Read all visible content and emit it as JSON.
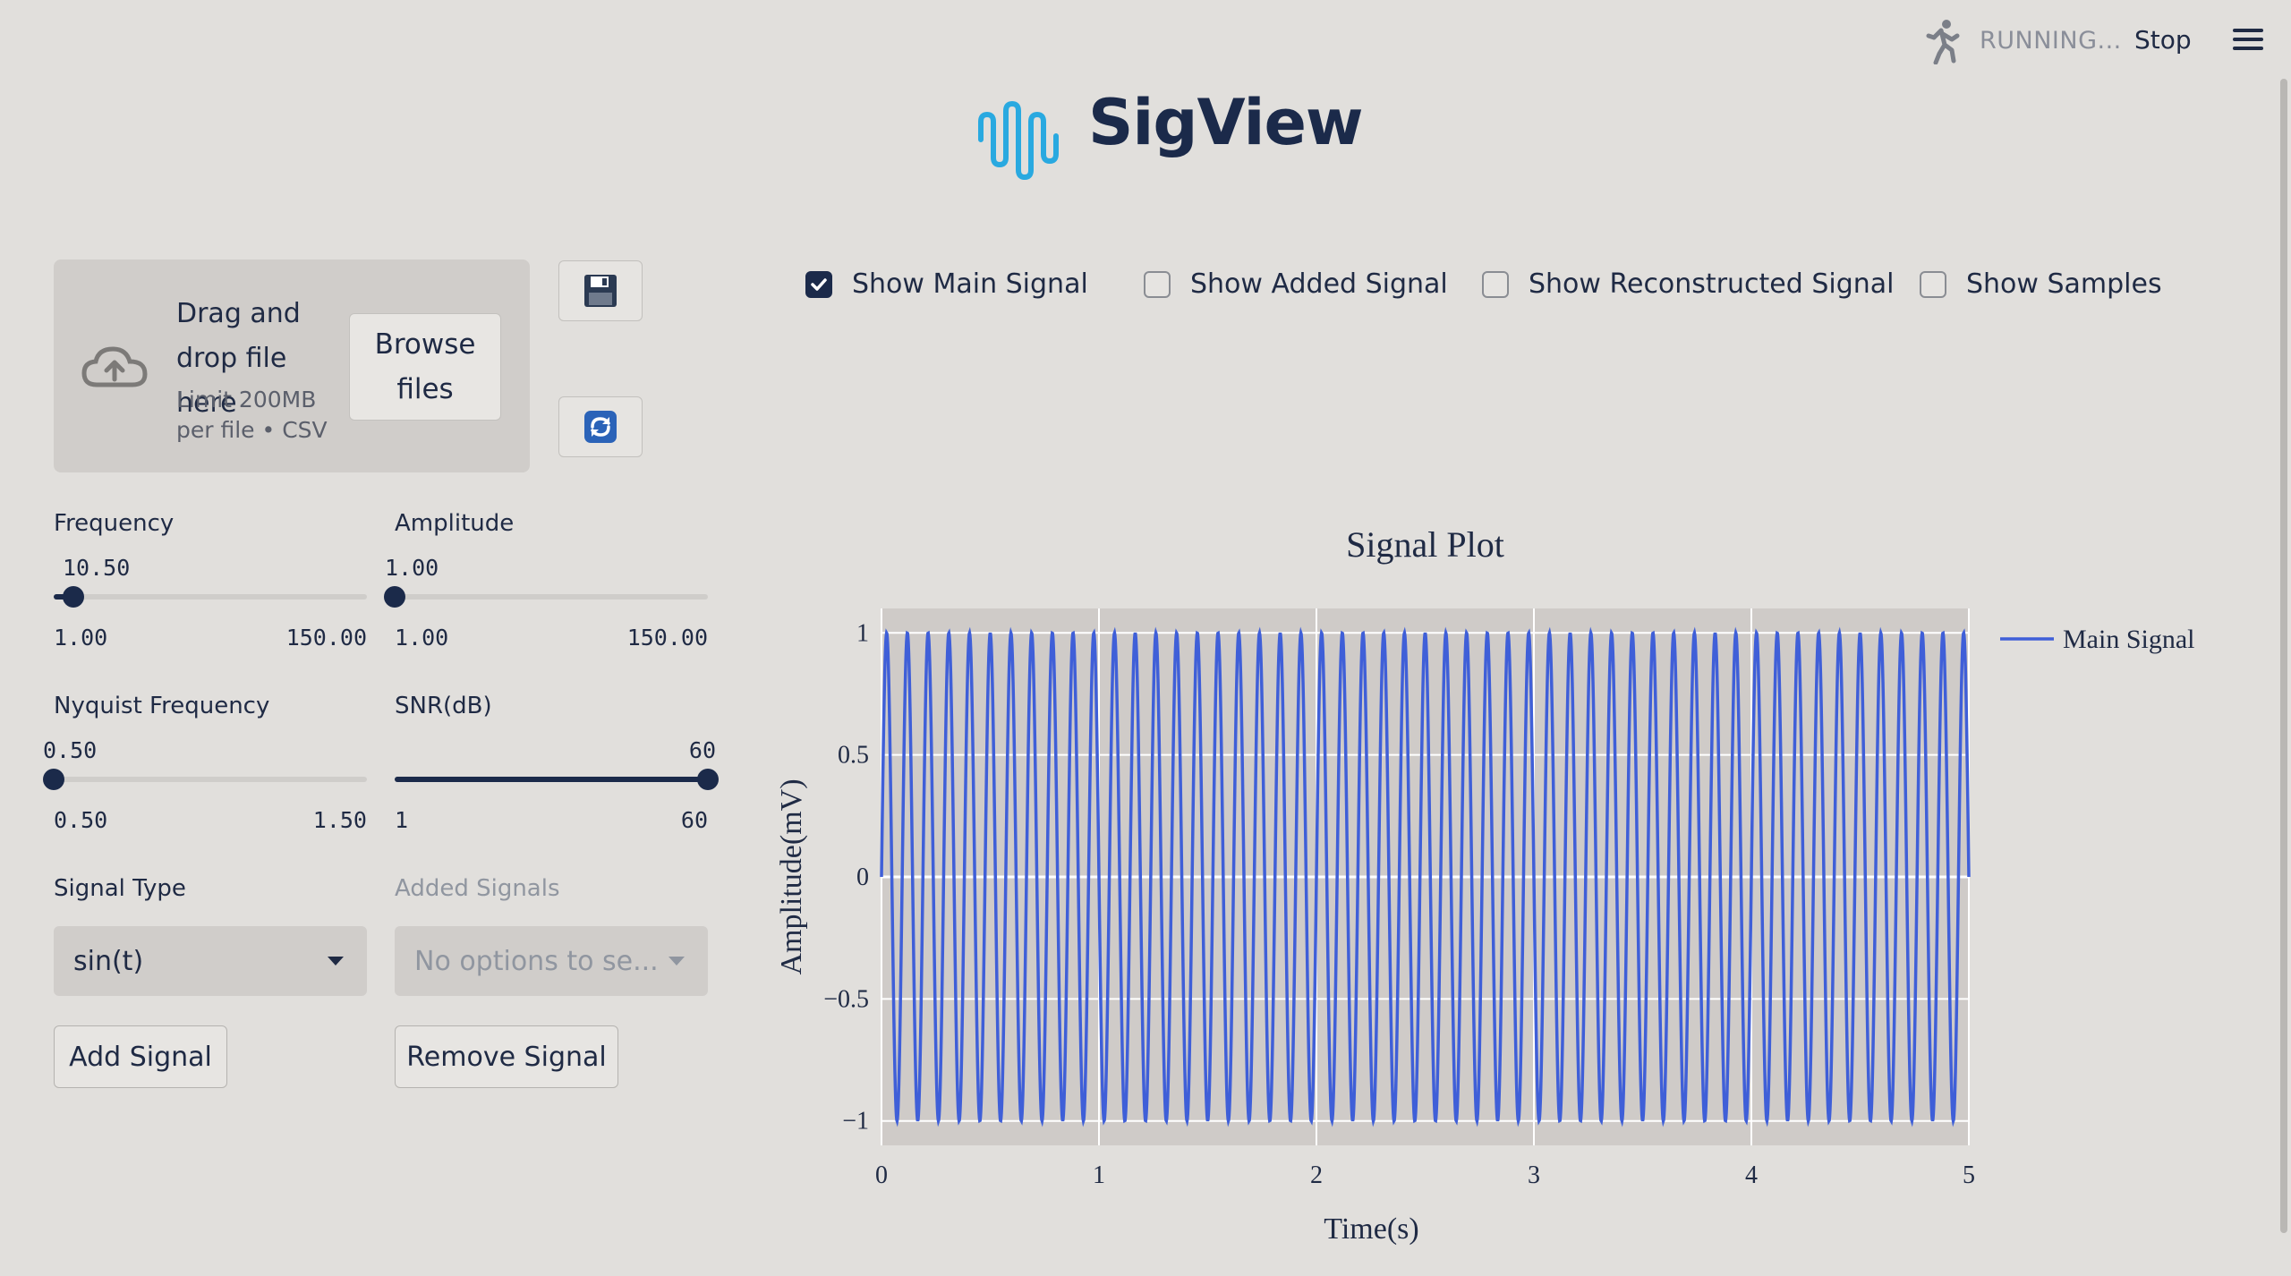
{
  "topbar": {
    "status_text": "RUNNING...",
    "stop_label": "Stop"
  },
  "app": {
    "title": "SigView"
  },
  "uploader": {
    "drag_text": "Drag and drop file here",
    "limit_text": "Limit 200MB per file • CSV",
    "browse_label": "Browse files"
  },
  "sliders": {
    "frequency": {
      "label": "Frequency",
      "value": "10.50",
      "min": "1.00",
      "max": "150.00",
      "fraction": 0.064
    },
    "amplitude": {
      "label": "Amplitude",
      "value": "1.00",
      "min": "1.00",
      "max": "150.00",
      "fraction": 0.0
    },
    "nyquist": {
      "label": "Nyquist Frequency",
      "value": "0.50",
      "min": "0.50",
      "max": "1.50",
      "fraction": 0.0
    },
    "snr": {
      "label": "SNR(dB)",
      "value": "60",
      "min": "1",
      "max": "60",
      "fraction": 1.0
    }
  },
  "signal_type": {
    "label": "Signal Type",
    "selected": "sin(t)"
  },
  "added_signals": {
    "label": "Added Signals",
    "placeholder": "No options to se..."
  },
  "buttons": {
    "add_signal": "Add Signal",
    "remove_signal": "Remove Signal"
  },
  "checkboxes": [
    {
      "label": "Show Main Signal",
      "checked": true
    },
    {
      "label": "Show Added Signal",
      "checked": false
    },
    {
      "label": "Show Reconstructed Signal",
      "checked": false
    },
    {
      "label": "Show Samples",
      "checked": false
    }
  ],
  "colors": {
    "accent": "#1b2a4a",
    "series": "#3f5fd8",
    "logo": "#29a9e0"
  },
  "chart_data": {
    "type": "line",
    "title": "Signal Plot",
    "xlabel": "Time(s)",
    "ylabel": "Amplitude(mV)",
    "xlim": [
      0,
      5
    ],
    "ylim": [
      -1.1,
      1.1
    ],
    "x_ticks": [
      "0",
      "1",
      "2",
      "3",
      "4",
      "5"
    ],
    "y_ticks": [
      {
        "value": 1,
        "label": "1"
      },
      {
        "value": 0.5,
        "label": "0.5"
      },
      {
        "value": 0,
        "label": "0"
      },
      {
        "value": -0.5,
        "label": "−0.5"
      },
      {
        "value": -1,
        "label": "−1"
      }
    ],
    "grid": true,
    "legend": "right",
    "series": [
      {
        "name": "Main Signal",
        "function": "sin",
        "frequency_hz": 10.5,
        "amplitude": 1.0
      }
    ]
  }
}
